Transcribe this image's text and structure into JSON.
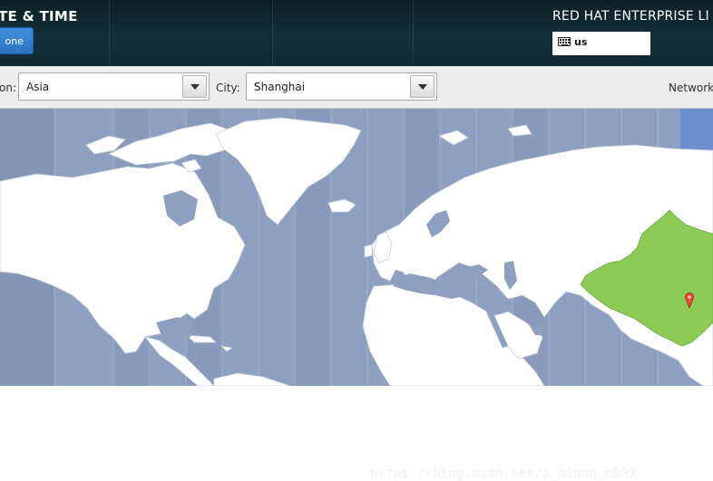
{
  "header": {
    "title": "TE & TIME",
    "done_label": "one",
    "product": "RED HAT ENTERPRISE LI",
    "keyboard_layout": "us"
  },
  "toolbar": {
    "region_label": "on:",
    "region_value": "Asia",
    "city_label": "City:",
    "city_value": "Shanghai",
    "network_label": "Network"
  },
  "map": {
    "selected_city": "Shanghai",
    "highlighted_country": "China",
    "colors": {
      "ocean": "#8da0c1",
      "land": "#ffffff",
      "highlight": "#8ccb55",
      "pin": "#e74c3c"
    }
  },
  "watermark": "https://blog.csdn.net/a_minnn_m897"
}
